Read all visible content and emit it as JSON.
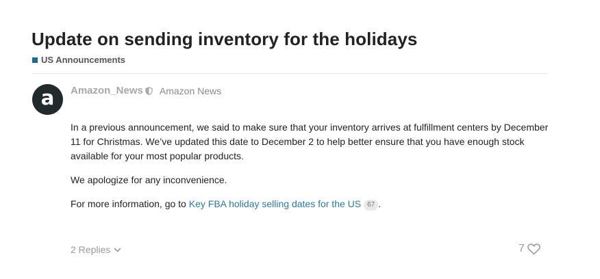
{
  "topic": {
    "title": "Update on sending inventory for the holidays",
    "category": {
      "label": "US Announcements",
      "color": "#1e6a8d"
    }
  },
  "post": {
    "avatar_letter": "a",
    "username": "Amazon_News",
    "moderator_icon": "shield-icon",
    "full_name": "Amazon News",
    "paragraph_1": "In a previous announcement, we said to make sure that your inventory arrives at fulfillment centers by December 11 for Christmas. We’ve updated this date to December 2 to help better ensure that you have enough stock available for your most popular products.",
    "paragraph_2": "We apologize for any inconvenience.",
    "paragraph_3_prefix": "For more information, go to ",
    "link_text": "Key FBA holiday selling dates for the US",
    "link_clicks": "67",
    "paragraph_3_suffix": "."
  },
  "footer": {
    "replies_label": "2 Replies",
    "like_count": "7"
  },
  "colors": {
    "link": "#2e7a9f",
    "muted": "#9a9a9a"
  }
}
